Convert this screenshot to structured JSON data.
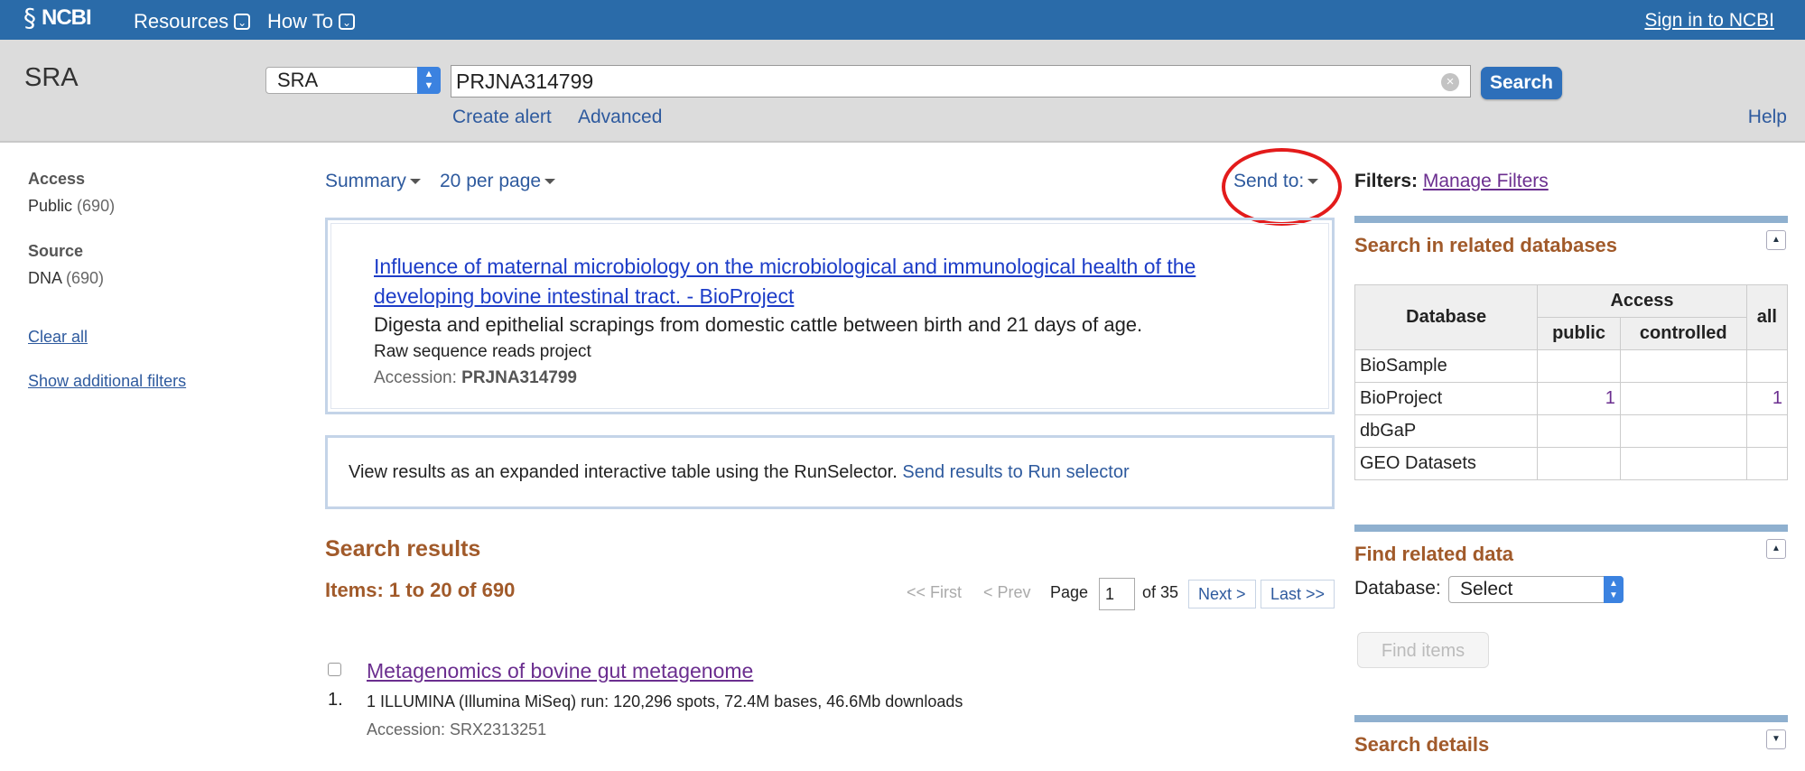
{
  "header": {
    "logo_text": "NCBI",
    "menu": [
      {
        "label": "Resources"
      },
      {
        "label": "How To"
      }
    ],
    "signin": "Sign in to NCBI"
  },
  "search": {
    "db_title": "SRA",
    "db_selected": "SRA",
    "query": "PRJNA314799",
    "button": "Search",
    "create_alert": "Create alert",
    "advanced": "Advanced",
    "help": "Help"
  },
  "sidebar": {
    "access_heading": "Access",
    "access_value": "Public",
    "access_count": "(690)",
    "source_heading": "Source",
    "source_value": "DNA",
    "source_count": "(690)",
    "clear_all": "Clear all",
    "show_filters": "Show additional filters"
  },
  "controls": {
    "format": "Summary",
    "per_page": "20 per page",
    "send_to": "Send to:"
  },
  "project": {
    "title": "Influence of maternal microbiology on the microbiological and immunological health of the developing bovine intestinal tract. - BioProject",
    "description": "Digesta and epithelial scrapings from domestic cattle between birth and 21 days of age.",
    "type": "Raw sequence reads project",
    "accession_label": "Accession:",
    "accession": "PRJNA314799"
  },
  "runselector": {
    "text": "View results as an expanded interactive table using the RunSelector.",
    "link": "Send results to Run selector"
  },
  "results": {
    "heading": "Search results",
    "items_text": "Items: 1 to 20 of 690",
    "pager": {
      "first": "<< First",
      "prev": "< Prev",
      "page_label": "Page",
      "page_value": "1",
      "of": "of 35",
      "next": "Next >",
      "last": "Last >>"
    },
    "list": [
      {
        "num": "1.",
        "title": "Metagenomics of bovine gut metagenome",
        "desc": "1 ILLUMINA (Illumina MiSeq) run: 120,296 spots, 72.4M bases, 46.6Mb downloads",
        "accession": "Accession: SRX2313251"
      }
    ]
  },
  "right": {
    "filters_label": "Filters:",
    "manage_filters": "Manage Filters",
    "related_heading": "Search in related databases",
    "table": {
      "col_db": "Database",
      "col_access": "Access",
      "col_public": "public",
      "col_controlled": "controlled",
      "col_all": "all",
      "rows": [
        {
          "db": "BioSample",
          "public": "",
          "controlled": "",
          "all": ""
        },
        {
          "db": "BioProject",
          "public": "1",
          "controlled": "",
          "all": "1"
        },
        {
          "db": "dbGaP",
          "public": "",
          "controlled": "",
          "all": ""
        },
        {
          "db": "GEO Datasets",
          "public": "",
          "controlled": "",
          "all": ""
        }
      ]
    },
    "find_heading": "Find related data",
    "database_label": "Database:",
    "database_select": "Select",
    "find_button": "Find items",
    "details_heading": "Search details"
  },
  "colors": {
    "header_bg": "#2a6ba9",
    "band_bg": "#dcdcdc",
    "section_heading": "#a15a2a",
    "link": "#2e5a9e",
    "visited_link": "#6b2e8f",
    "highlight_circle": "#e31b1b"
  }
}
